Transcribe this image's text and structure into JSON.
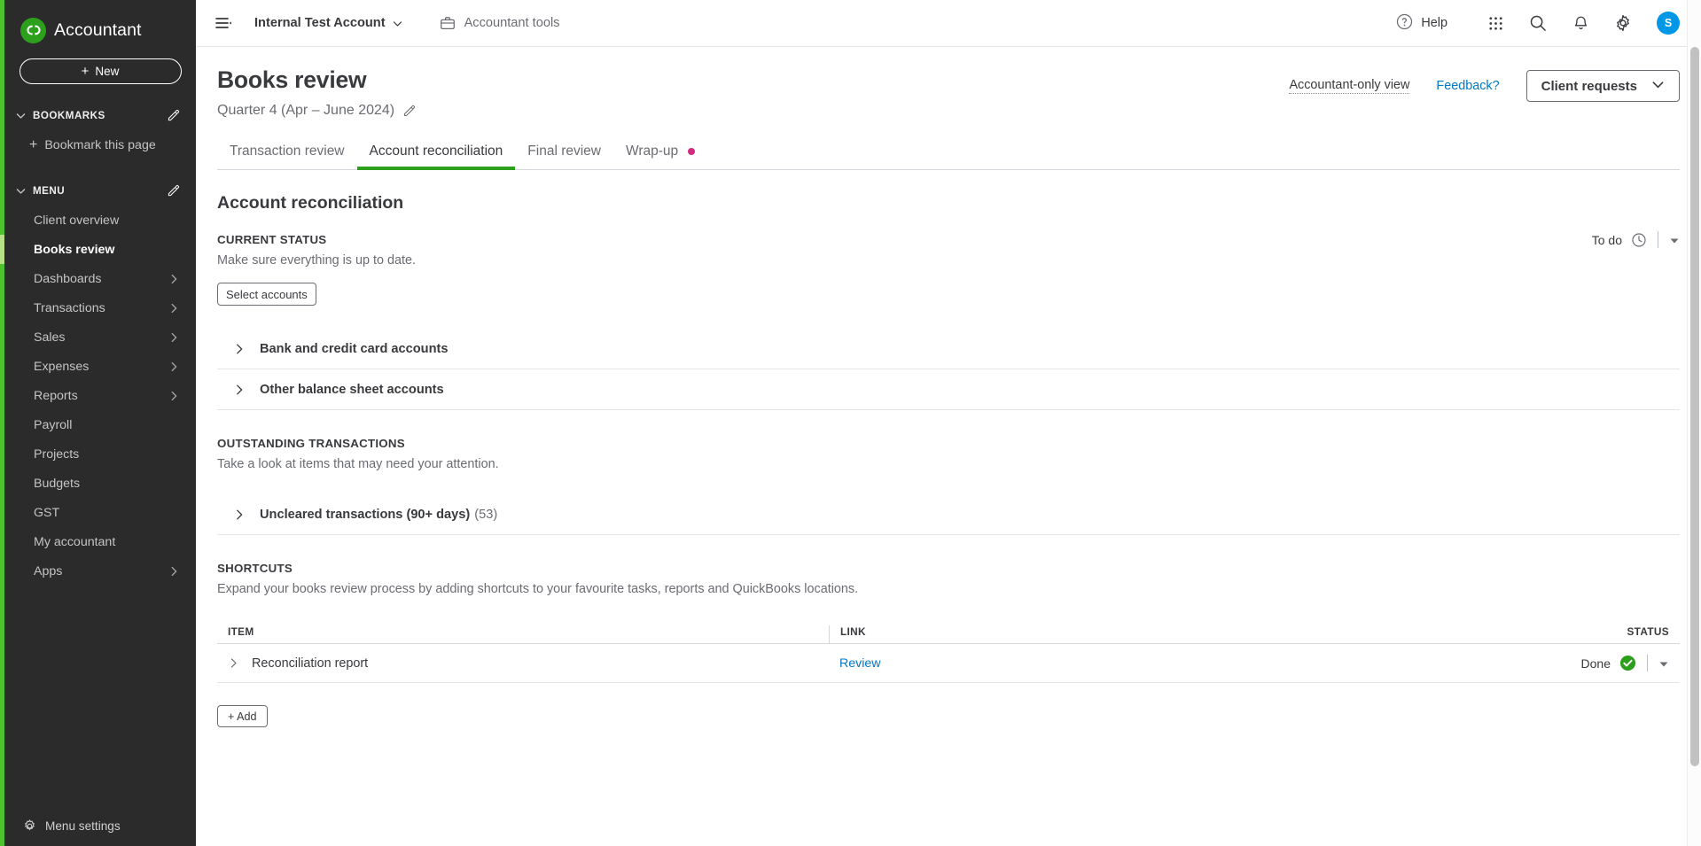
{
  "sidebar": {
    "brand": "Accountant",
    "brand_logo_text": "qb",
    "new_button": "New",
    "new_plus": "+",
    "bookmarks": {
      "label": "BOOKMARKS",
      "add_label": "Bookmark this page",
      "add_plus": "+"
    },
    "menu": {
      "label": "MENU",
      "items": [
        {
          "label": "Client overview",
          "expandable": false,
          "active": false
        },
        {
          "label": "Books review",
          "expandable": false,
          "active": true
        },
        {
          "label": "Dashboards",
          "expandable": true,
          "active": false
        },
        {
          "label": "Transactions",
          "expandable": true,
          "active": false
        },
        {
          "label": "Sales",
          "expandable": true,
          "active": false
        },
        {
          "label": "Expenses",
          "expandable": true,
          "active": false
        },
        {
          "label": "Reports",
          "expandable": true,
          "active": false
        },
        {
          "label": "Payroll",
          "expandable": false,
          "active": false
        },
        {
          "label": "Projects",
          "expandable": false,
          "active": false
        },
        {
          "label": "Budgets",
          "expandable": false,
          "active": false
        },
        {
          "label": "GST",
          "expandable": false,
          "active": false
        },
        {
          "label": "My accountant",
          "expandable": false,
          "active": false
        },
        {
          "label": "Apps",
          "expandable": true,
          "active": false
        }
      ]
    },
    "footer": "Menu settings",
    "accent_color": "#4ec22c",
    "active_marker_color": "#b9e088",
    "background": "#2b2b2b"
  },
  "topbar": {
    "company": "Internal Test Account",
    "accountant_tools": "Accountant tools",
    "help": "Help",
    "avatar_initial": "S",
    "avatar_color": "#0097e6"
  },
  "page": {
    "title": "Books review",
    "subtitle": "Quarter 4 (Apr – June 2024)",
    "accountant_only_view": "Accountant-only view",
    "feedback": "Feedback?",
    "client_requests": "Client requests"
  },
  "tabs": [
    {
      "label": "Transaction review",
      "active": false,
      "dot": false
    },
    {
      "label": "Account reconciliation",
      "active": true,
      "dot": false
    },
    {
      "label": "Final review",
      "active": false,
      "dot": false
    },
    {
      "label": "Wrap-up",
      "active": false,
      "dot": true
    }
  ],
  "tab_active_color": "#2ca01c",
  "tab_dot_color": "#d52b7e",
  "main": {
    "section_title": "Account reconciliation",
    "current_status": {
      "eyebrow": "CURRENT STATUS",
      "blurb": "Make sure everything is up to date.",
      "select_accounts_button": "Select accounts",
      "status_label": "To do",
      "rows": [
        {
          "label": "Bank and credit card accounts",
          "count": ""
        },
        {
          "label": "Other balance sheet accounts",
          "count": ""
        }
      ]
    },
    "outstanding": {
      "eyebrow": "OUTSTANDING TRANSACTIONS",
      "blurb": "Take a look at items that may need your attention.",
      "rows": [
        {
          "label": "Uncleared transactions (90+ days)",
          "count": "(53)"
        }
      ]
    },
    "shortcuts": {
      "eyebrow": "SHORTCUTS",
      "blurb": "Expand your books review process by adding shortcuts to your favourite tasks, reports and QuickBooks locations.",
      "columns": {
        "item": "ITEM",
        "link": "LINK",
        "status": "STATUS"
      },
      "rows": [
        {
          "item": "Reconciliation report",
          "link": "Review",
          "status": "Done"
        }
      ],
      "add_button": "+ Add",
      "done_color": "#2ca01c"
    }
  }
}
